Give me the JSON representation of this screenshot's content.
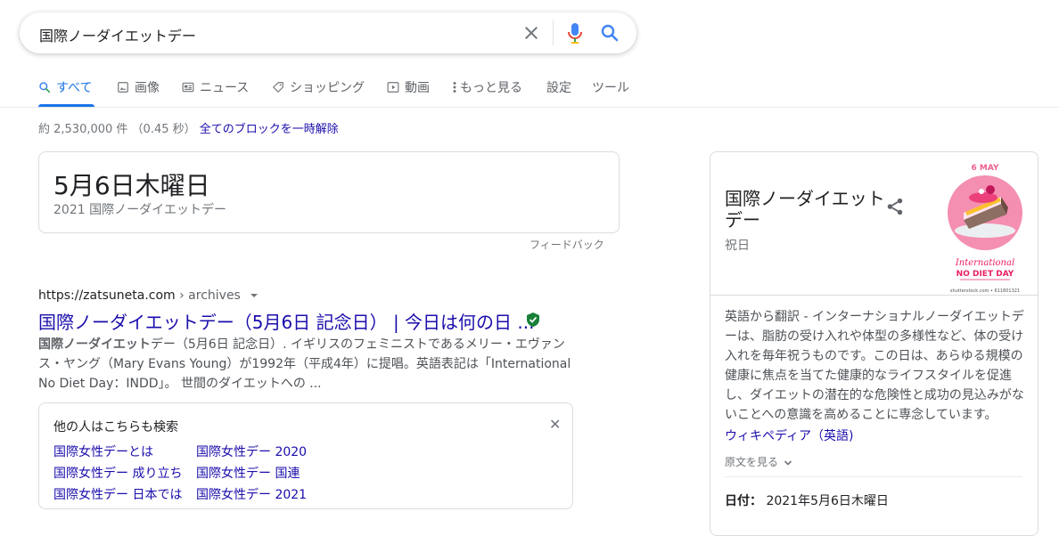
{
  "search": {
    "query": "国際ノーダイエットデー",
    "clear_icon": "close-icon",
    "mic_icon": "microphone-icon",
    "search_icon": "search-icon"
  },
  "tabs": [
    {
      "label": "すべて",
      "icon": "search-icon"
    },
    {
      "label": "画像",
      "icon": "image-icon"
    },
    {
      "label": "ニュース",
      "icon": "news-icon"
    },
    {
      "label": "ショッピング",
      "icon": "tag-icon"
    },
    {
      "label": "動画",
      "icon": "play-icon"
    },
    {
      "label": "もっと見る",
      "icon": "more-vert-icon"
    },
    {
      "label": "設定",
      "icon": ""
    },
    {
      "label": "ツール",
      "icon": ""
    }
  ],
  "stats": {
    "count": "約 2,530,000 件 （0.45 秒）",
    "unblock": "全てのブロックを一時解除"
  },
  "answer": {
    "main": "5月6日木曜日",
    "sub": "2021 国際ノーダイエットデー",
    "feedback": "フィードバック"
  },
  "result": {
    "site": "https://zatsuneta.com",
    "crumb": " › archives",
    "title": "国際ノーダイエットデー（5月6日 記念日） | 今日は何の日 ...",
    "snippet_bold": "国際ノーダイエット",
    "snippet_rest": "デー（5月6日 記念日）. イギリスのフェミニストであるメリー・エヴァンス・ヤング（Mary Evans Young）が1992年（平成4年）に提唱。英語表記は「International No Diet Day：INDD」。 世間のダイエットへの ..."
  },
  "people_also_search": {
    "title": "他の人はこちらも検索",
    "links": [
      "国際女性デーとは",
      "国際女性デー 2020",
      "国際女性デー 成り立ち",
      "国際女性デー 国連",
      "国際女性デー 日本では",
      "国際女性デー 2021"
    ]
  },
  "knowledge_panel": {
    "title": "国際ノーダイエットデー",
    "type": "祝日",
    "image": {
      "top": "6 MAY",
      "line1": "International",
      "line2": "NO DIET DAY",
      "credit": "shutterstock.com • 611801321"
    },
    "description": "英語から翻訳 - インターナショナルノーダイエットデーは、脂肪の受け入れや体型の多様性など、体の受け入れを毎年祝うものです。この日は、あらゆる規模の健康に焦点を当てた健康的なライフスタイルを促進し、ダイエットの潜在的な危険性と成功の見込みがないことへの意識を高めることに専念しています。",
    "wiki_link": "ウィキペディア（英語)",
    "original": "原文を見る",
    "date_label": "日付：",
    "date_value": "2021年5月6日木曜日"
  },
  "colors": {
    "link": "#1a0dab",
    "accent": "#1a73e8",
    "verified": "#188038"
  }
}
